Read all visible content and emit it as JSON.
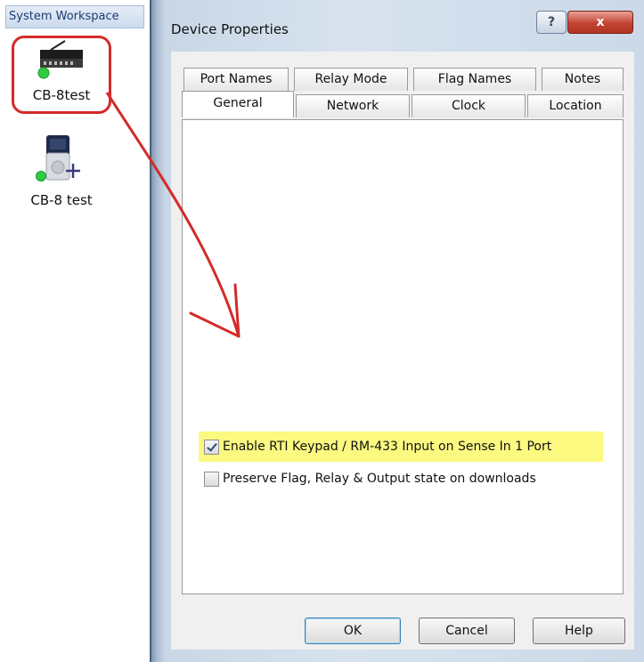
{
  "workspace": {
    "title": "System Workspace",
    "devices": [
      {
        "label": "CB-8test",
        "icon": "relay-controller-icon"
      },
      {
        "label": "CB-8 test",
        "icon": "remote-add-device-icon"
      }
    ]
  },
  "dialog": {
    "title": "Device Properties",
    "help_glyph": "?",
    "close_glyph": "x",
    "tabs_back": [
      "Port Names",
      "Relay Mode",
      "Flag Names",
      "Notes"
    ],
    "tabs_front": [
      "General",
      "Network",
      "Clock",
      "Location"
    ],
    "active_tab": "General",
    "checkboxes": [
      {
        "label": "Enable RTI Keypad / RM-433 Input on Sense In 1 Port",
        "checked": true
      },
      {
        "label": "Preserve Flag, Relay & Output state on downloads",
        "checked": false
      }
    ],
    "buttons": {
      "ok": "OK",
      "cancel": "Cancel",
      "help": "Help"
    }
  },
  "colors": {
    "annotation_red": "#d42a2a",
    "highlight_yellow": "#fbf86a",
    "status_green": "#2ecc40"
  }
}
